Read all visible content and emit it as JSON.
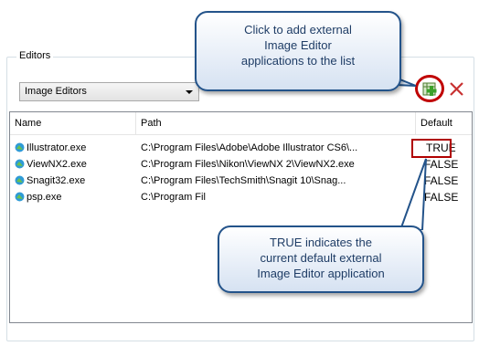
{
  "editors_group": {
    "title": "Editors",
    "category_select": {
      "value": "Image Editors"
    }
  },
  "toolbar": {
    "add_icon": "add-editor-icon",
    "remove_icon": "remove-editor-icon"
  },
  "table": {
    "columns": [
      "Name",
      "Path",
      "Default"
    ],
    "rows": [
      {
        "name": "Illustrator.exe",
        "path": "C:\\Program Files\\Adobe\\Adobe Illustrator CS6\\...",
        "default": "TRUE"
      },
      {
        "name": "ViewNX2.exe",
        "path": "C:\\Program Files\\Nikon\\ViewNX 2\\ViewNX2.exe",
        "default": "FALSE"
      },
      {
        "name": "Snagit32.exe",
        "path": "C:\\Program Files\\TechSmith\\Snagit 10\\Snag...",
        "default": "FALSE"
      },
      {
        "name": "psp.exe",
        "path": "C:\\Program Fil",
        "default": "FALSE"
      }
    ]
  },
  "callouts": {
    "add": [
      "Click to add external",
      "Image Editor",
      "applications to the list"
    ],
    "default": [
      "TRUE indicates the",
      "current default external",
      "Image Editor application"
    ]
  },
  "colors": {
    "highlight": "#c00000",
    "callout_border": "#23538a",
    "callout_text": "#1f3d66"
  }
}
